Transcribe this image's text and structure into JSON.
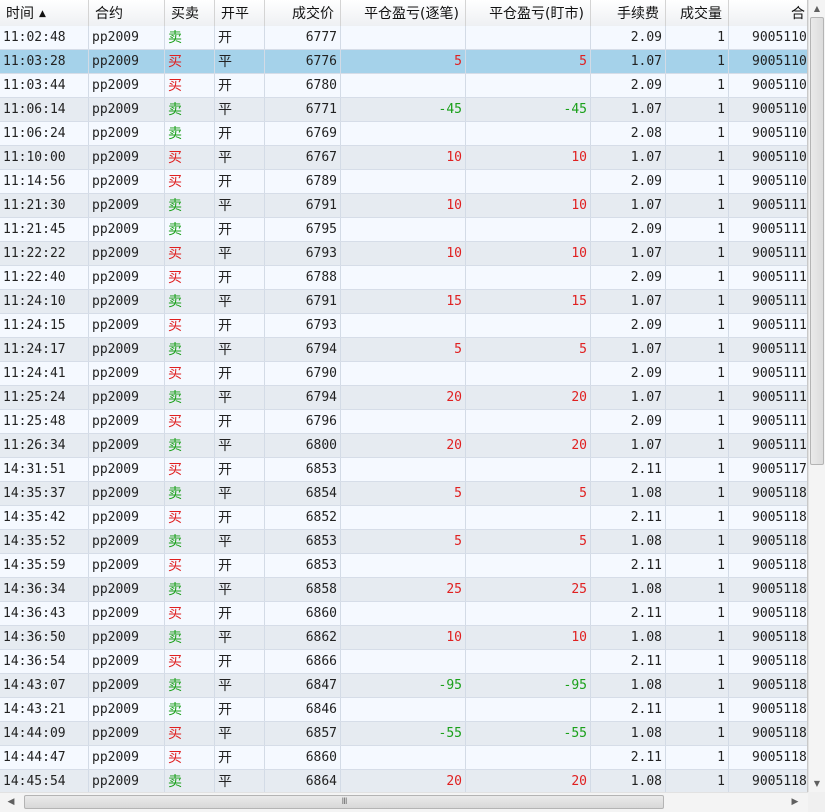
{
  "columns": {
    "time": "时间",
    "contract": "合约",
    "side": "买卖",
    "openclose": "开平",
    "price": "成交价",
    "pnl_trade": "平仓盈亏(逐笔)",
    "pnl_mark": "平仓盈亏(盯市)",
    "fee": "手续费",
    "volume": "成交量",
    "extra": "合"
  },
  "sort_indicator": "▲",
  "selected_row_index": 1,
  "rows": [
    {
      "time": "11:02:48",
      "contract": "pp2009",
      "side": "卖",
      "openclose": "开",
      "price": "6777",
      "pnl_trade": "",
      "pnl_mark": "",
      "fee": "2.09",
      "volume": "1",
      "id": "9005110"
    },
    {
      "time": "11:03:28",
      "contract": "pp2009",
      "side": "买",
      "openclose": "平",
      "price": "6776",
      "pnl_trade": "5",
      "pnl_mark": "5",
      "fee": "1.07",
      "volume": "1",
      "id": "9005110"
    },
    {
      "time": "11:03:44",
      "contract": "pp2009",
      "side": "买",
      "openclose": "开",
      "price": "6780",
      "pnl_trade": "",
      "pnl_mark": "",
      "fee": "2.09",
      "volume": "1",
      "id": "9005110"
    },
    {
      "time": "11:06:14",
      "contract": "pp2009",
      "side": "卖",
      "openclose": "平",
      "price": "6771",
      "pnl_trade": "-45",
      "pnl_mark": "-45",
      "fee": "1.07",
      "volume": "1",
      "id": "9005110"
    },
    {
      "time": "11:06:24",
      "contract": "pp2009",
      "side": "卖",
      "openclose": "开",
      "price": "6769",
      "pnl_trade": "",
      "pnl_mark": "",
      "fee": "2.08",
      "volume": "1",
      "id": "9005110"
    },
    {
      "time": "11:10:00",
      "contract": "pp2009",
      "side": "买",
      "openclose": "平",
      "price": "6767",
      "pnl_trade": "10",
      "pnl_mark": "10",
      "fee": "1.07",
      "volume": "1",
      "id": "9005110"
    },
    {
      "time": "11:14:56",
      "contract": "pp2009",
      "side": "买",
      "openclose": "开",
      "price": "6789",
      "pnl_trade": "",
      "pnl_mark": "",
      "fee": "2.09",
      "volume": "1",
      "id": "9005110"
    },
    {
      "time": "11:21:30",
      "contract": "pp2009",
      "side": "卖",
      "openclose": "平",
      "price": "6791",
      "pnl_trade": "10",
      "pnl_mark": "10",
      "fee": "1.07",
      "volume": "1",
      "id": "9005111"
    },
    {
      "time": "11:21:45",
      "contract": "pp2009",
      "side": "卖",
      "openclose": "开",
      "price": "6795",
      "pnl_trade": "",
      "pnl_mark": "",
      "fee": "2.09",
      "volume": "1",
      "id": "9005111"
    },
    {
      "time": "11:22:22",
      "contract": "pp2009",
      "side": "买",
      "openclose": "平",
      "price": "6793",
      "pnl_trade": "10",
      "pnl_mark": "10",
      "fee": "1.07",
      "volume": "1",
      "id": "9005111"
    },
    {
      "time": "11:22:40",
      "contract": "pp2009",
      "side": "买",
      "openclose": "开",
      "price": "6788",
      "pnl_trade": "",
      "pnl_mark": "",
      "fee": "2.09",
      "volume": "1",
      "id": "9005111"
    },
    {
      "time": "11:24:10",
      "contract": "pp2009",
      "side": "卖",
      "openclose": "平",
      "price": "6791",
      "pnl_trade": "15",
      "pnl_mark": "15",
      "fee": "1.07",
      "volume": "1",
      "id": "9005111"
    },
    {
      "time": "11:24:15",
      "contract": "pp2009",
      "side": "买",
      "openclose": "开",
      "price": "6793",
      "pnl_trade": "",
      "pnl_mark": "",
      "fee": "2.09",
      "volume": "1",
      "id": "9005111"
    },
    {
      "time": "11:24:17",
      "contract": "pp2009",
      "side": "卖",
      "openclose": "平",
      "price": "6794",
      "pnl_trade": "5",
      "pnl_mark": "5",
      "fee": "1.07",
      "volume": "1",
      "id": "9005111"
    },
    {
      "time": "11:24:41",
      "contract": "pp2009",
      "side": "买",
      "openclose": "开",
      "price": "6790",
      "pnl_trade": "",
      "pnl_mark": "",
      "fee": "2.09",
      "volume": "1",
      "id": "9005111"
    },
    {
      "time": "11:25:24",
      "contract": "pp2009",
      "side": "卖",
      "openclose": "平",
      "price": "6794",
      "pnl_trade": "20",
      "pnl_mark": "20",
      "fee": "1.07",
      "volume": "1",
      "id": "9005111"
    },
    {
      "time": "11:25:48",
      "contract": "pp2009",
      "side": "买",
      "openclose": "开",
      "price": "6796",
      "pnl_trade": "",
      "pnl_mark": "",
      "fee": "2.09",
      "volume": "1",
      "id": "9005111"
    },
    {
      "time": "11:26:34",
      "contract": "pp2009",
      "side": "卖",
      "openclose": "平",
      "price": "6800",
      "pnl_trade": "20",
      "pnl_mark": "20",
      "fee": "1.07",
      "volume": "1",
      "id": "9005111"
    },
    {
      "time": "14:31:51",
      "contract": "pp2009",
      "side": "买",
      "openclose": "开",
      "price": "6853",
      "pnl_trade": "",
      "pnl_mark": "",
      "fee": "2.11",
      "volume": "1",
      "id": "9005117"
    },
    {
      "time": "14:35:37",
      "contract": "pp2009",
      "side": "卖",
      "openclose": "平",
      "price": "6854",
      "pnl_trade": "5",
      "pnl_mark": "5",
      "fee": "1.08",
      "volume": "1",
      "id": "9005118"
    },
    {
      "time": "14:35:42",
      "contract": "pp2009",
      "side": "买",
      "openclose": "开",
      "price": "6852",
      "pnl_trade": "",
      "pnl_mark": "",
      "fee": "2.11",
      "volume": "1",
      "id": "9005118"
    },
    {
      "time": "14:35:52",
      "contract": "pp2009",
      "side": "卖",
      "openclose": "平",
      "price": "6853",
      "pnl_trade": "5",
      "pnl_mark": "5",
      "fee": "1.08",
      "volume": "1",
      "id": "9005118"
    },
    {
      "time": "14:35:59",
      "contract": "pp2009",
      "side": "买",
      "openclose": "开",
      "price": "6853",
      "pnl_trade": "",
      "pnl_mark": "",
      "fee": "2.11",
      "volume": "1",
      "id": "9005118"
    },
    {
      "time": "14:36:34",
      "contract": "pp2009",
      "side": "卖",
      "openclose": "平",
      "price": "6858",
      "pnl_trade": "25",
      "pnl_mark": "25",
      "fee": "1.08",
      "volume": "1",
      "id": "9005118"
    },
    {
      "time": "14:36:43",
      "contract": "pp2009",
      "side": "买",
      "openclose": "开",
      "price": "6860",
      "pnl_trade": "",
      "pnl_mark": "",
      "fee": "2.11",
      "volume": "1",
      "id": "9005118"
    },
    {
      "time": "14:36:50",
      "contract": "pp2009",
      "side": "卖",
      "openclose": "平",
      "price": "6862",
      "pnl_trade": "10",
      "pnl_mark": "10",
      "fee": "1.08",
      "volume": "1",
      "id": "9005118"
    },
    {
      "time": "14:36:54",
      "contract": "pp2009",
      "side": "买",
      "openclose": "开",
      "price": "6866",
      "pnl_trade": "",
      "pnl_mark": "",
      "fee": "2.11",
      "volume": "1",
      "id": "9005118"
    },
    {
      "time": "14:43:07",
      "contract": "pp2009",
      "side": "卖",
      "openclose": "平",
      "price": "6847",
      "pnl_trade": "-95",
      "pnl_mark": "-95",
      "fee": "1.08",
      "volume": "1",
      "id": "9005118"
    },
    {
      "time": "14:43:21",
      "contract": "pp2009",
      "side": "卖",
      "openclose": "开",
      "price": "6846",
      "pnl_trade": "",
      "pnl_mark": "",
      "fee": "2.11",
      "volume": "1",
      "id": "9005118"
    },
    {
      "time": "14:44:09",
      "contract": "pp2009",
      "side": "买",
      "openclose": "平",
      "price": "6857",
      "pnl_trade": "-55",
      "pnl_mark": "-55",
      "fee": "1.08",
      "volume": "1",
      "id": "9005118"
    },
    {
      "time": "14:44:47",
      "contract": "pp2009",
      "side": "买",
      "openclose": "开",
      "price": "6860",
      "pnl_trade": "",
      "pnl_mark": "",
      "fee": "2.11",
      "volume": "1",
      "id": "9005118"
    },
    {
      "time": "14:45:54",
      "contract": "pp2009",
      "side": "卖",
      "openclose": "平",
      "price": "6864",
      "pnl_trade": "20",
      "pnl_mark": "20",
      "fee": "1.08",
      "volume": "1",
      "id": "9005118"
    }
  ],
  "scrollbar": {
    "up_arrow": "▲",
    "down_arrow": "▼",
    "left_arrow": "◀",
    "right_arrow": "▶",
    "grip": "III"
  },
  "colors": {
    "buy": "#e02020",
    "sell": "#1aa01a",
    "selected_row": "#a5d2ea"
  }
}
